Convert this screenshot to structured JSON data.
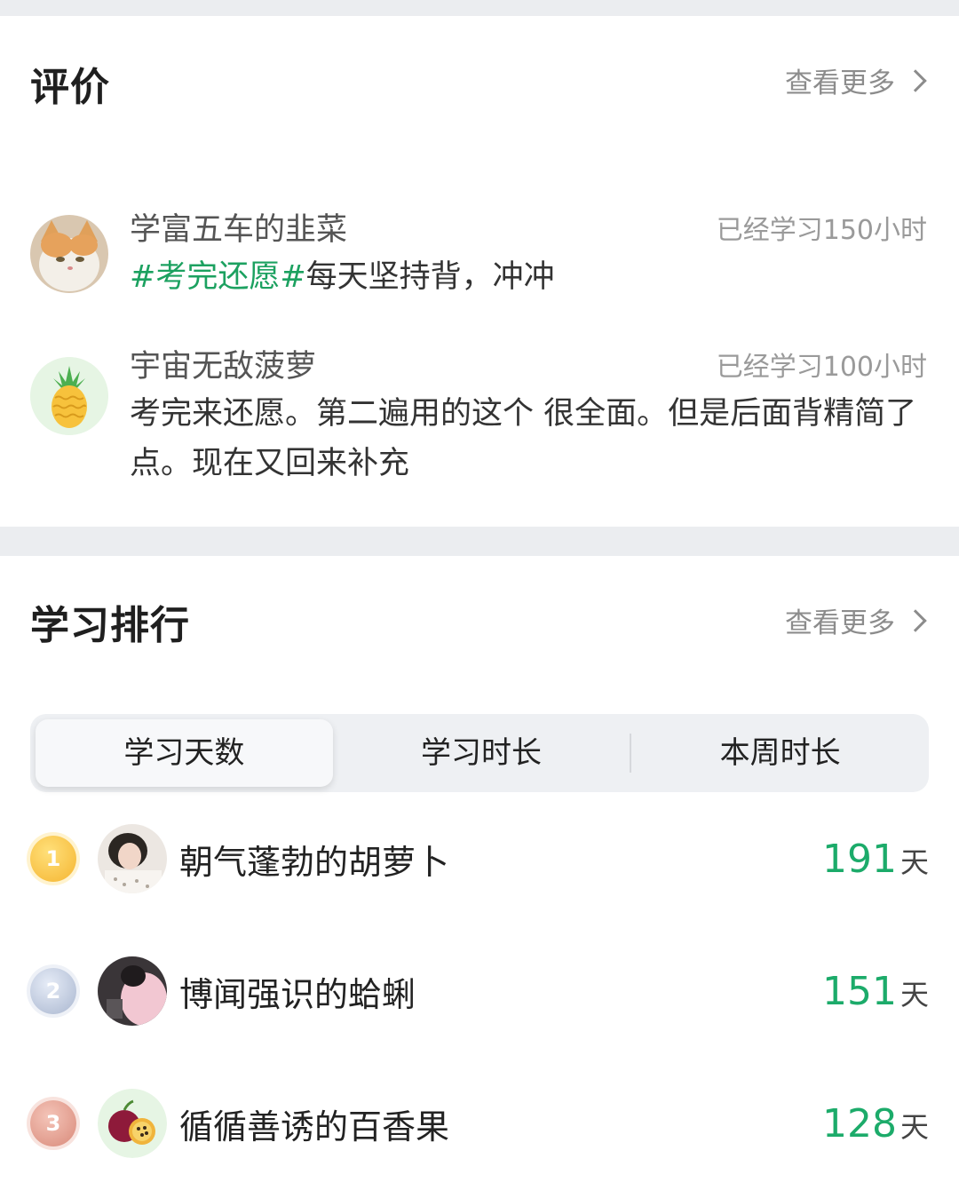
{
  "reviews_section": {
    "title": "评价",
    "more_label": "查看更多",
    "items": [
      {
        "name": "学富五车的韭菜",
        "hours": "已经学习150小时",
        "tag": "#考完还愿#",
        "text": "每天坚持背，冲冲",
        "avatar_icon": "cat-avatar-icon"
      },
      {
        "name": "宇宙无敌菠萝",
        "hours": "已经学习100小时",
        "tag": "",
        "text": "考完来还愿。第二遍用的这个 很全面。但是后面背精简了点。现在又回来补充",
        "avatar_icon": "pineapple-avatar-icon"
      }
    ]
  },
  "ranking_section": {
    "title": "学习排行",
    "more_label": "查看更多",
    "tabs": [
      {
        "label": "学习天数",
        "active": true
      },
      {
        "label": "学习时长",
        "active": false
      },
      {
        "label": "本周时长",
        "active": false
      }
    ],
    "rows": [
      {
        "rank": "1",
        "name": "朝气蓬勃的胡萝卜",
        "value": "191",
        "unit": "天"
      },
      {
        "rank": "2",
        "name": "博闻强识的蛤蜊",
        "value": "151",
        "unit": "天"
      },
      {
        "rank": "3",
        "name": "循循善诱的百香果",
        "value": "128",
        "unit": "天"
      }
    ]
  },
  "colors": {
    "accent_green": "#1cab6a",
    "tag_green": "#1ca160",
    "gold": "#f5b531",
    "silver": "#b9c3d6",
    "bronze": "#e09a8a"
  }
}
